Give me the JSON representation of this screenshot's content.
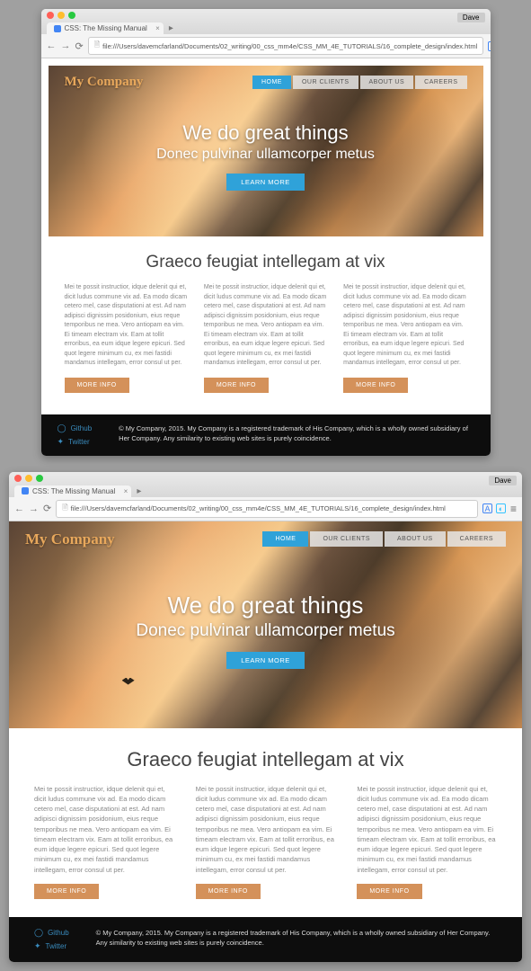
{
  "browsers": [
    {
      "chrome": {
        "tab_title": "CSS: The Missing Manual",
        "user": "Dave",
        "url": "file:///Users/davemcfarland/Documents/02_writing/00_css_mm4e/CSS_MM_4E_TUTORIALS/16_complete_design/index.html"
      }
    },
    {
      "chrome": {
        "tab_title": "CSS: The Missing Manual",
        "user": "Dave",
        "url": "file:///Users/davemcfarland/Documents/02_writing/00_css_mm4e/CSS_MM_4E_TUTORIALS/16_complete_design/index.html"
      }
    }
  ],
  "site": {
    "logo": "My Company",
    "nav": [
      {
        "label": "HOME",
        "active": true
      },
      {
        "label": "OUR CLIENTS",
        "active": false
      },
      {
        "label": "ABOUT US",
        "active": false
      },
      {
        "label": "CAREERS",
        "active": false
      }
    ],
    "hero": {
      "headline": "We do great things",
      "subhead": "Donec pulvinar ullamcorper metus",
      "cta": "LEARN MORE"
    },
    "section_title": "Graeco feugiat intellegam at vix",
    "column_text": "Mei te possit instructior, idque delenit qui et, dicit ludus commune vix ad. Ea modo dicam cetero mel, case disputationi at est. Ad nam adipisci dignissim posidonium, eius reque temporibus ne mea. Vero antiopam ea vim. Ei timeam electram vix. Eam at tollit erroribus, ea eum idque legere epicuri. Sed quot legere minimum cu, ex mei fastidi mandamus intellegam, error consul ut per.",
    "more_btn": "MORE INFO",
    "footer": {
      "social": [
        {
          "name": "Github",
          "icon": "github-icon"
        },
        {
          "name": "Twitter",
          "icon": "twitter-icon"
        }
      ],
      "copyright": "© My Company, 2015. My Company is a registered trademark of His Company, which is a wholly owned subsidiary of Her Company. Any similarity to existing web sites is purely coincidence."
    }
  }
}
